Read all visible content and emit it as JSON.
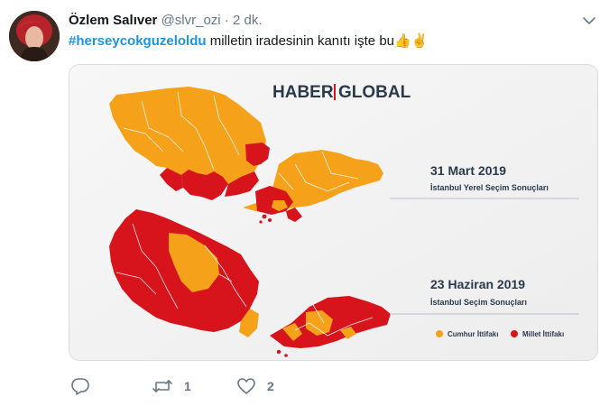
{
  "tweet": {
    "author_name": "Özlem Salıver",
    "handle": "@slvr_ozi",
    "separator": "·",
    "time": "2 dk.",
    "hashtag": "#herseycokguzeloldu",
    "text": "milletin iradesinin kanıtı işte bu",
    "emoji": "👍✌"
  },
  "media": {
    "brand_left": "HABER",
    "brand_right": "GLOBAL",
    "map1_date": "31 Mart 2019",
    "map1_caption": "İstanbul Yerel Seçim Sonuçları",
    "map2_date": "23 Haziran 2019",
    "map2_caption": "İstanbul Seçim Sonuçları",
    "legend": [
      {
        "label": "Cumhur İttifakı",
        "color": "#f5a21a"
      },
      {
        "label": "Millet İttifakı",
        "color": "#d7131b"
      }
    ]
  },
  "actions": {
    "reply_count": "",
    "retweet_count": "1",
    "like_count": "2"
  },
  "icons": [
    "avatar",
    "chevron-down-icon",
    "reply-icon",
    "retweet-icon",
    "like-icon"
  ]
}
